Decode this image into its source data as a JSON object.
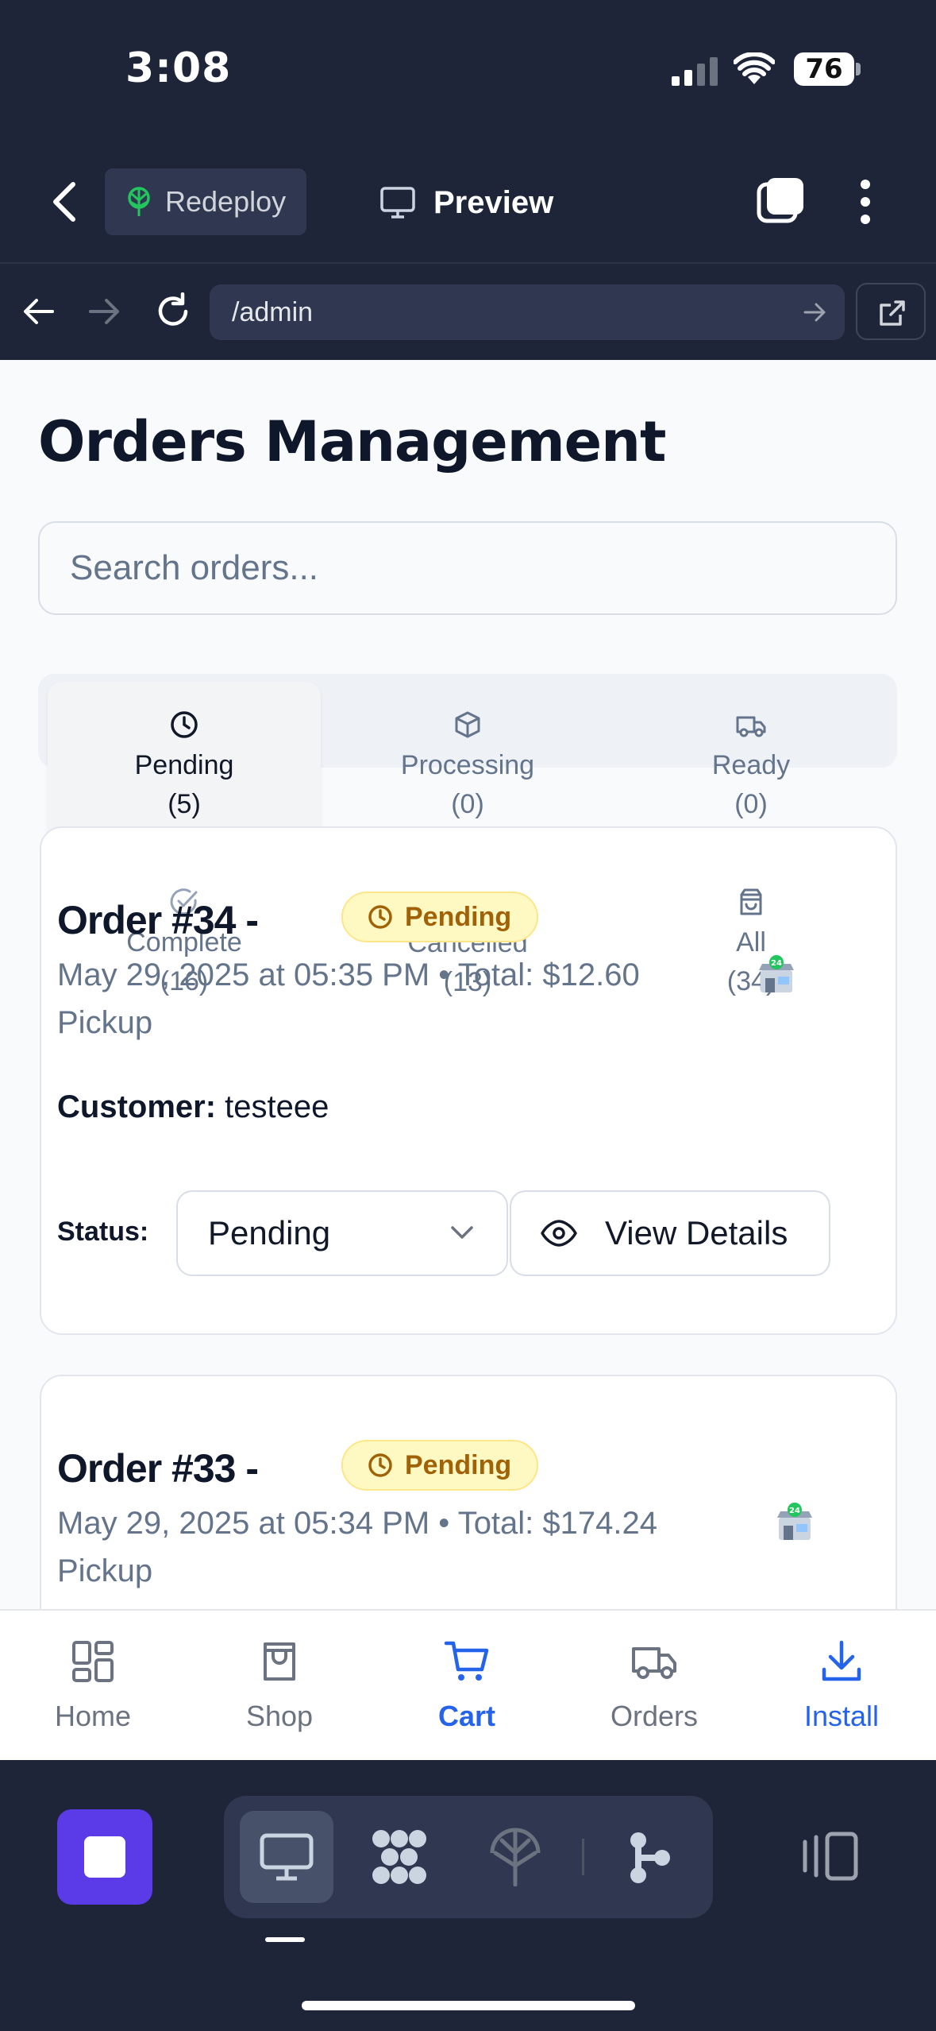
{
  "status_bar": {
    "time": "3:08",
    "battery": "76"
  },
  "app_toolbar": {
    "redeploy_label": "Redeploy",
    "preview_label": "Preview"
  },
  "url_bar": {
    "url": "/admin"
  },
  "page": {
    "title": "Orders Management",
    "search_placeholder": "Search orders...",
    "tabs": [
      {
        "label": "Pending",
        "count": "(5)",
        "icon": "clock-icon",
        "active": true
      },
      {
        "label": "Processing",
        "count": "(0)",
        "icon": "package-icon"
      },
      {
        "label": "Ready",
        "count": "(0)",
        "icon": "truck-icon"
      },
      {
        "label": "Complete",
        "count": "(16)",
        "icon": "check-circle-icon"
      },
      {
        "label": "Cancelled",
        "count": "(13)",
        "icon": "x-icon"
      },
      {
        "label": "All",
        "count": "(34)",
        "icon": "bag-icon"
      }
    ],
    "orders": [
      {
        "title": "Order #34 -",
        "badge": "Pending",
        "meta_line1": "May 29, 2025 at 05:35 PM • Total: $12.60",
        "meta_line2": "Pickup",
        "customer_label": "Customer:",
        "customer_name": "testeee",
        "status_label": "Status:",
        "status_value": "Pending",
        "details_label": "View Details"
      },
      {
        "title": "Order #33 -",
        "badge": "Pending",
        "meta_line1": "May 29, 2025 at 05:34 PM • Total: $174.24",
        "meta_line2": "Pickup"
      }
    ]
  },
  "bottom_nav": [
    {
      "label": "Home",
      "icon": "grid-icon"
    },
    {
      "label": "Shop",
      "icon": "shop-icon"
    },
    {
      "label": "Cart",
      "icon": "cart-icon",
      "active": true
    },
    {
      "label": "Orders",
      "icon": "truck-icon"
    },
    {
      "label": "Install",
      "icon": "download-icon",
      "accent": true
    }
  ],
  "colors": {
    "accent": "#2563eb",
    "badge_bg": "#fef9c3",
    "badge_text": "#a16207",
    "dark_bg": "#1e2538",
    "stop_button": "#5b3be8"
  }
}
